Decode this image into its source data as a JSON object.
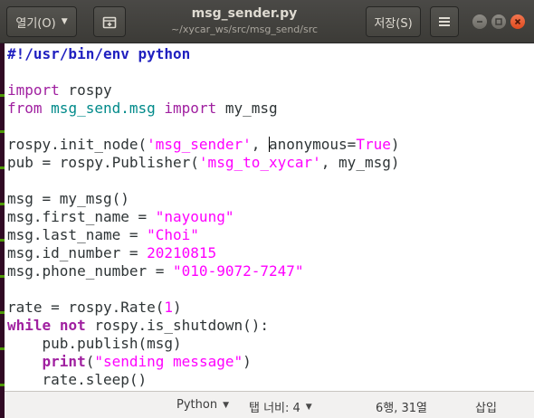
{
  "header": {
    "open_label": "열기(O)",
    "title": "msg_sender.py",
    "subtitle": "~/xycar_ws/src/msg_send/src",
    "save_label": "저장(S)"
  },
  "code": {
    "l1": {
      "a": "#!/usr/bin/env python"
    },
    "l3": {
      "a": "import",
      "b": " rospy"
    },
    "l4": {
      "a": "from",
      "b": " ",
      "c": "msg_send.msg",
      "d": " ",
      "e": "import",
      "f": " my_msg"
    },
    "l6": {
      "a": "rospy.init_node(",
      "b": "'msg_sender'",
      "c": ", ",
      "d": "anonymous=",
      "e": "True",
      "f": ")"
    },
    "l7": {
      "a": "pub = rospy.Publisher(",
      "b": "'msg_to_xycar'",
      "c": ", my_msg)"
    },
    "l9": {
      "a": "msg = my_msg()"
    },
    "l10": {
      "a": "msg.first_name = ",
      "b": "\"nayoung\""
    },
    "l11": {
      "a": "msg.last_name = ",
      "b": "\"Choi\""
    },
    "l12": {
      "a": "msg.id_number = ",
      "b": "20210815"
    },
    "l13": {
      "a": "msg.phone_number = ",
      "b": "\"010-9072-7247\""
    },
    "l15": {
      "a": "rate = rospy.Rate(",
      "b": "1",
      "c": ")"
    },
    "l16": {
      "a": "while",
      "b": " ",
      "c": "not",
      "d": " rospy.is_shutdown():"
    },
    "l17": {
      "a": "    pub.publish(msg)"
    },
    "l18": {
      "a": "    ",
      "b": "print",
      "c": "(",
      "d": "\"sending message\"",
      "e": ")"
    },
    "l19": {
      "a": "    rate.sleep()"
    }
  },
  "status": {
    "language": "Python",
    "tab_width": "탭 너비: 4",
    "position": "6행, 31열",
    "mode": "삽입"
  }
}
